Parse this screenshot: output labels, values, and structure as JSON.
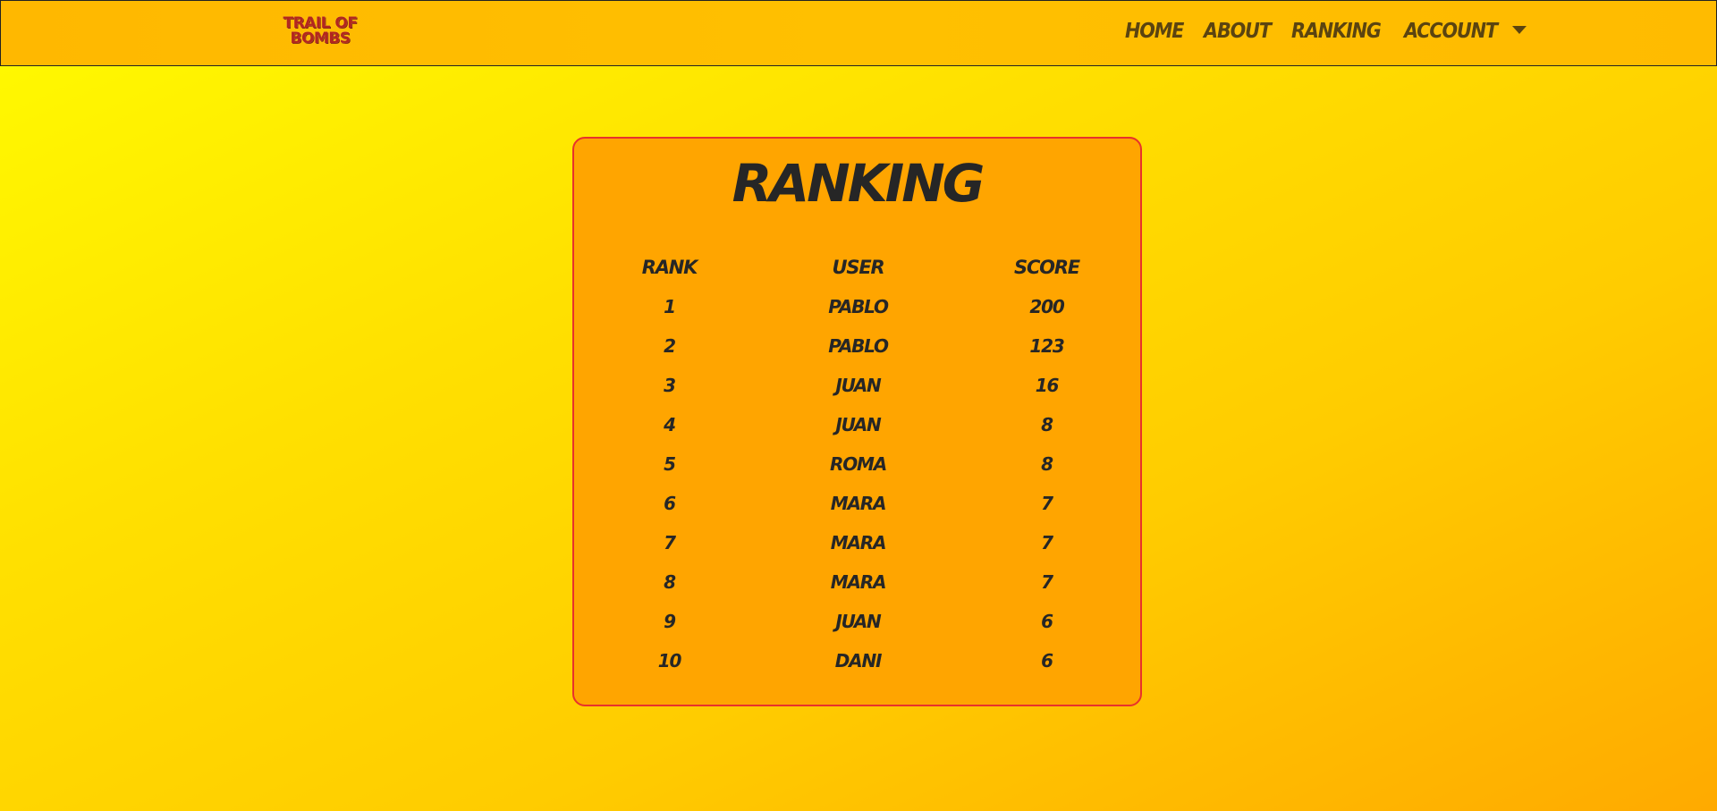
{
  "brand": {
    "line1": "TRAIL OF",
    "line2": "BOMBS"
  },
  "nav": {
    "home": "HOME",
    "about": "ABOUT",
    "ranking": "RANKING",
    "account": "ACCOUNT"
  },
  "ranking": {
    "title": "RANKING",
    "columns": [
      "RANK",
      "USER",
      "SCORE"
    ],
    "rows": [
      [
        "1",
        "PABLO",
        "200"
      ],
      [
        "2",
        "PABLO",
        "123"
      ],
      [
        "3",
        "JUAN",
        "16"
      ],
      [
        "4",
        "JUAN",
        "8"
      ],
      [
        "5",
        "ROMA",
        "8"
      ],
      [
        "6",
        "MARA",
        "7"
      ],
      [
        "7",
        "MARA",
        "7"
      ],
      [
        "8",
        "MARA",
        "7"
      ],
      [
        "9",
        "JUAN",
        "6"
      ],
      [
        "10",
        "DANI",
        "6"
      ]
    ]
  },
  "colors": {
    "card_background": "#ffa500",
    "card_border": "#e8322b",
    "nav_text": "#5b4410",
    "text": "#262626"
  }
}
